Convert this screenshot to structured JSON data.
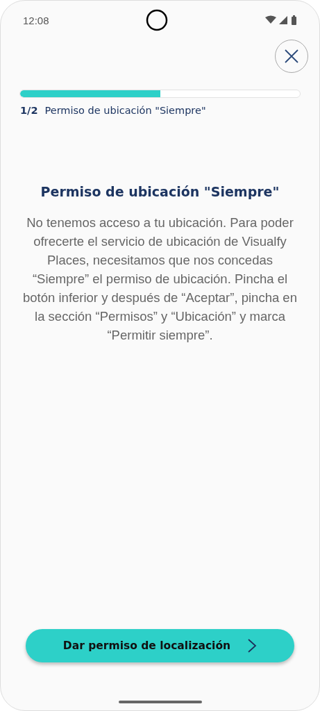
{
  "status_bar": {
    "time": "12:08"
  },
  "progress": {
    "level": 0.5,
    "step": "1/2",
    "label": "Permiso de ubicación \"Siempre\""
  },
  "title": "Permiso de ubicación \"Siempre\"",
  "body": "No tenemos acceso a tu ubicación. Para poder ofrecerte el servicio de ubicación de Visualfy Places, necesitamos que nos concedas “Siempre” el permiso de ubicación. Pincha el botón inferior y después de “Aceptar”, pincha en la sección “Permisos” y “Ubicación” y marca “Permitir siempre”.",
  "button": {
    "label": "Dar permiso de localización"
  }
}
